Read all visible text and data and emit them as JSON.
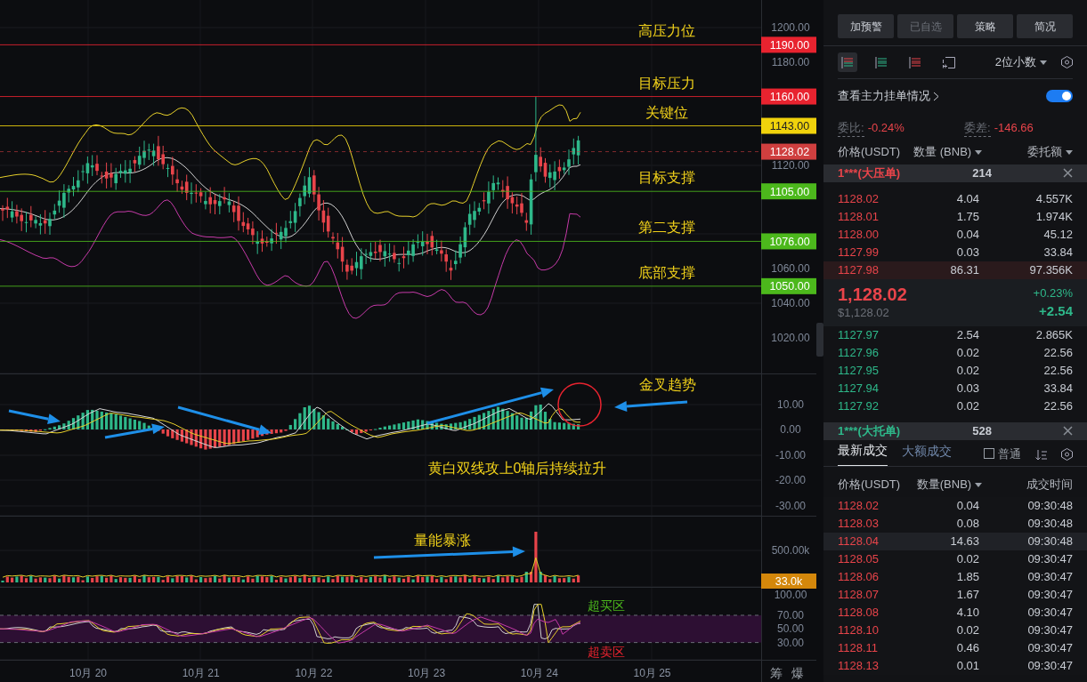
{
  "chart": {
    "price_axis": [
      "1200.00",
      "1180.00",
      "1120.00",
      "1060.00",
      "1040.00",
      "1020.00"
    ],
    "levels": [
      {
        "label": "1190.00",
        "color": "#e8232f",
        "kind": "target",
        "note": "高压力位"
      },
      {
        "label": "1160.00",
        "color": "#e8232f",
        "kind": "target",
        "note": "目标压力"
      },
      {
        "label": "1143.00",
        "color": "#f0d20c",
        "kind": "target",
        "note": "关键位"
      },
      {
        "label": "1128.02",
        "color": "#cf3f3f",
        "kind": "current"
      },
      {
        "label": "1105.00",
        "color": "#4cb81c",
        "kind": "target",
        "note": "目标支撑"
      },
      {
        "label": "1076.00",
        "color": "#4cb81c",
        "kind": "target",
        "note": "第二支撑"
      },
      {
        "label": "1050.00",
        "color": "#4cb81c",
        "kind": "target",
        "note": "底部支撑"
      }
    ],
    "macd_axis": [
      "10.00",
      "0.00",
      "-10.00",
      "-20.00",
      "-30.00"
    ],
    "macd_notes": [
      "金叉趋势",
      "黄白双线攻上0轴后持续拉升"
    ],
    "volume_axis": [
      "500.00k"
    ],
    "volume_tag": "33.0k",
    "volume_note": "量能暴涨",
    "rsi_axis": [
      "100.00",
      "70.00",
      "50.00",
      "30.00"
    ],
    "rsi_notes": [
      {
        "label": "超买区",
        "kind": "overbought"
      },
      {
        "label": "超卖区",
        "kind": "oversold"
      }
    ],
    "dates": [
      "10月 20",
      "10月 21",
      "10月 22",
      "10月 23",
      "10月 24",
      "10月 25"
    ],
    "corner_buttons": [
      "筹",
      "爆"
    ]
  },
  "panel": {
    "actions": [
      {
        "label": "加预警",
        "disabled": false
      },
      {
        "label": "已自选",
        "disabled": true
      },
      {
        "label": "策略",
        "disabled": false
      },
      {
        "label": "简况",
        "disabled": false
      }
    ],
    "views": [
      {
        "kind": "both",
        "selected": true
      },
      {
        "kind": "bids",
        "selected": false
      },
      {
        "kind": "asks",
        "selected": false
      },
      {
        "kind": "custom",
        "selected": false
      }
    ],
    "decimals": "2位小数",
    "main_orders": {
      "label": "查看主力挂单情况",
      "on": true
    },
    "ratio": {
      "label": "委比:",
      "value": "-0.24%"
    },
    "diff": {
      "label": "委差:",
      "value": "-146.66"
    },
    "book_columns": [
      "价格(USDT)",
      "数量 (BNB)",
      "委托额"
    ],
    "ask_alert": {
      "label": "1***(大压单)",
      "amount": "214"
    },
    "asks": [
      {
        "price": "1128.02",
        "qty": "4.04",
        "total": "4.557K",
        "highlighted": false
      },
      {
        "price": "1128.01",
        "qty": "1.75",
        "total": "1.974K",
        "highlighted": false
      },
      {
        "price": "1128.00",
        "qty": "0.04",
        "total": "45.12",
        "highlighted": false
      },
      {
        "price": "1127.99",
        "qty": "0.03",
        "total": "33.84",
        "highlighted": false
      },
      {
        "price": "1127.98",
        "qty": "86.31",
        "total": "97.356K",
        "highlighted": true
      }
    ],
    "last": {
      "price": "1,128.02",
      "usd": "$1,128.02",
      "pct": "+0.23%",
      "change": "+2.54"
    },
    "bids": [
      {
        "price": "1127.97",
        "qty": "2.54",
        "total": "2.865K",
        "highlighted": false
      },
      {
        "price": "1127.96",
        "qty": "0.02",
        "total": "22.56",
        "highlighted": false
      },
      {
        "price": "1127.95",
        "qty": "0.02",
        "total": "22.56",
        "highlighted": false
      },
      {
        "price": "1127.94",
        "qty": "0.03",
        "total": "33.84",
        "highlighted": false
      },
      {
        "price": "1127.92",
        "qty": "0.02",
        "total": "22.56",
        "highlighted": false
      }
    ],
    "bid_alert": {
      "label": "1***(大托单)",
      "amount": "528"
    },
    "trade_tabs": [
      {
        "label": "最新成交",
        "selected": true
      },
      {
        "label": "大额成交",
        "selected": false
      }
    ],
    "normal_filter": {
      "label": "普通",
      "checked": false
    },
    "trade_columns": [
      "价格(USDT)",
      "数量(BNB)",
      "成交时间"
    ],
    "trades": [
      {
        "price": "1128.02",
        "qty": "0.04",
        "time": "09:30:48",
        "highlighted": false
      },
      {
        "price": "1128.03",
        "qty": "0.08",
        "time": "09:30:48",
        "highlighted": false
      },
      {
        "price": "1128.04",
        "qty": "14.63",
        "time": "09:30:48",
        "highlighted": true
      },
      {
        "price": "1128.05",
        "qty": "0.02",
        "time": "09:30:47",
        "highlighted": false
      },
      {
        "price": "1128.06",
        "qty": "1.85",
        "time": "09:30:47",
        "highlighted": false
      },
      {
        "price": "1128.07",
        "qty": "1.67",
        "time": "09:30:47",
        "highlighted": false
      },
      {
        "price": "1128.08",
        "qty": "4.10",
        "time": "09:30:47",
        "highlighted": false
      },
      {
        "price": "1128.10",
        "qty": "0.02",
        "time": "09:30:47",
        "highlighted": false
      },
      {
        "price": "1128.11",
        "qty": "0.46",
        "time": "09:30:47",
        "highlighted": false
      },
      {
        "price": "1128.13",
        "qty": "0.01",
        "time": "09:30:47",
        "highlighted": false
      }
    ]
  }
}
